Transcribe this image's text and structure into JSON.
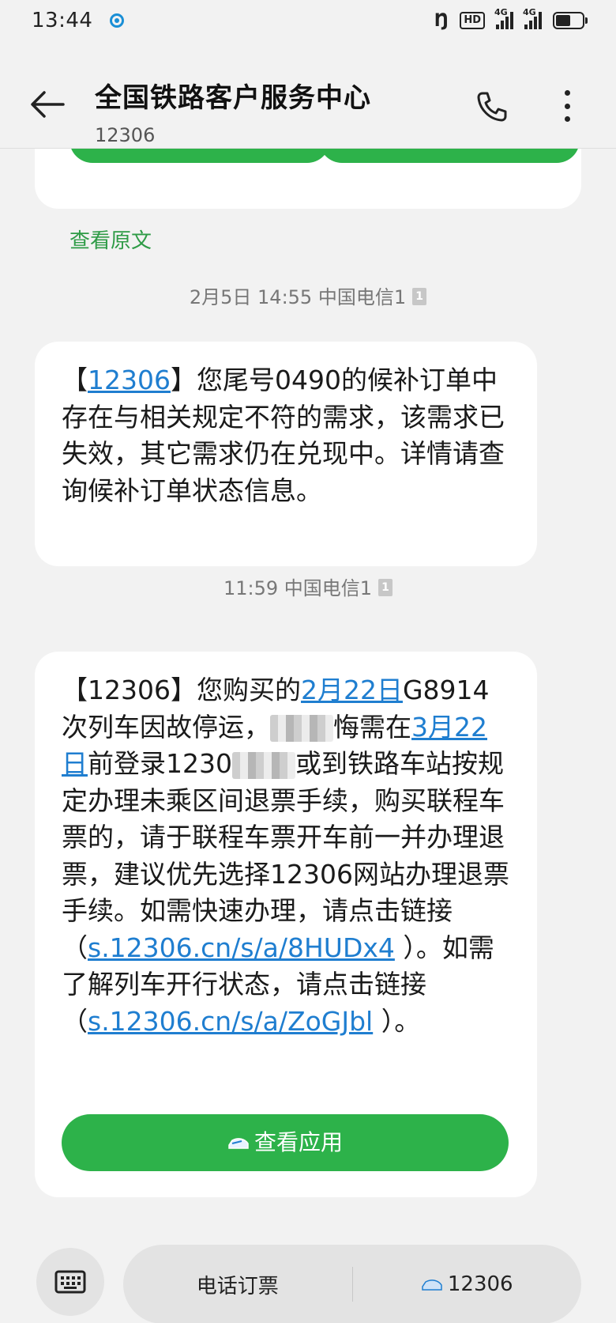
{
  "status_bar": {
    "time": "13:44",
    "hd_label": "HD",
    "net1_label": "4G",
    "net2_label": "4G"
  },
  "header": {
    "title": "全国铁路客户服务中心",
    "subtitle": "12306"
  },
  "view_original": "查看原文",
  "messages": [
    {
      "timestamp": "2月5日 14:55 中国电信1",
      "sim_label": "1",
      "text_open": "【",
      "link_12306": "12306",
      "text_body": "】您尾号0490的候补订单中存在与相关规定不符的需求，该需求已失效，其它需求仍在兑现中。详情请查询候补订单状态信息。"
    },
    {
      "timestamp": "11:59 中国电信1",
      "sim_label": "1",
      "t1": "【12306】您购买的",
      "link_date1": "2月22日",
      "t2": "G8914次列车因故停运，",
      "t3": "悔需在",
      "link_date2": "3月22日",
      "t4": "前登录1230",
      "t5": "或到铁路车站按规定办理未乘区间退票手续，购买联程车票的，请于联程车票开车前一并办理退票，建议优先选择12306网站办理退票手续。如需快速办理，请点击链接（",
      "link1": "s.12306.cn/s/a/8HUDx4",
      "t6": " ）。如需了解列车开行状态，请点击链接（",
      "link2": "s.12306.cn/s/a/ZoGJbl",
      "t7": " ）。",
      "button_label": "查看应用"
    }
  ],
  "bottom_bar": {
    "menu_items": [
      "电话订票",
      "12306"
    ]
  },
  "colors": {
    "accent_green": "#2db24a",
    "link_blue": "#1f7ed0"
  }
}
